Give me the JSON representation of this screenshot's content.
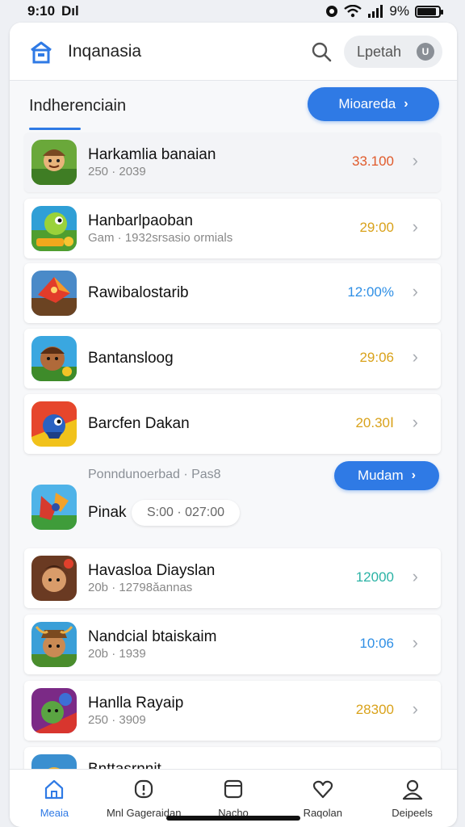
{
  "status_bar": {
    "time": "9:10",
    "carrier": "Dıl",
    "battery": "9%",
    "battery_level": 0.9
  },
  "header": {
    "title": "Inqanasia",
    "search_icon": "search-icon",
    "pill_label": "Lpetah",
    "pill_icon_glyph": "U"
  },
  "section": {
    "title": "Indherenciain",
    "button_label": "Mioareda",
    "button_chevron": "›"
  },
  "colors": {
    "accent": "#2f7ae5",
    "value_orange": "#e05a2b",
    "value_amber": "#d9a21b",
    "value_blue": "#2f7ae5",
    "value_teal": "#2bb3a5"
  },
  "items": [
    {
      "name": "Harkamlia banaian",
      "sub": "250 · 2039",
      "value": "33.100",
      "value_color": "#e05a2b",
      "chevron": "›"
    },
    {
      "name": "Hanbarlpaoban",
      "sub": "Gam · 1932srsasio ormials",
      "value": "29:00",
      "value_color": "#d9a21b",
      "chevron": "›"
    },
    {
      "name": "Rawibalostarib",
      "sub": "",
      "value": "12:00%",
      "value_color": "#2f8fe5",
      "chevron": "›"
    },
    {
      "name": "Bantansloog",
      "sub": "",
      "value": "29:06",
      "value_color": "#d9a21b",
      "chevron": "›"
    },
    {
      "name": "Barcfen Dakan",
      "sub": "",
      "value": "20.30Ⅰ",
      "value_color": "#d9a21b",
      "chevron": "›"
    }
  ],
  "promo": {
    "subtitle": "Ponndunoerbad · Pas8",
    "button_label": "Mudam",
    "button_chevron": "›",
    "name": "Pinak",
    "chip": "S:00 · 027:00"
  },
  "items2": [
    {
      "name": "Havasloa Diayslan",
      "sub": "20b · 12798ǎannas",
      "value": "12000",
      "value_color": "#2bb3a5",
      "chevron": "›"
    },
    {
      "name": "Nandcial btaiskaim",
      "sub": "20b · 1939",
      "value": "10:06",
      "value_color": "#2f8fe5",
      "chevron": "›"
    },
    {
      "name": "Hanlla Rayaip",
      "sub": "250 · 3909",
      "value": "28300",
      "value_color": "#d9a21b",
      "chevron": "›"
    },
    {
      "name": "Bnttasrnnit",
      "sub": "",
      "value": "",
      "value_color": "#d9a21b",
      "chevron": ""
    }
  ],
  "nav": [
    {
      "label": "Meaia",
      "icon": "home-icon"
    },
    {
      "label": "Mnl Gageraidan",
      "icon": "alert-icon"
    },
    {
      "label": "Nacho",
      "icon": "browser-icon"
    },
    {
      "label": "Raqolan",
      "icon": "heart-icon"
    },
    {
      "label": "Deipeels",
      "icon": "profile-icon"
    }
  ]
}
